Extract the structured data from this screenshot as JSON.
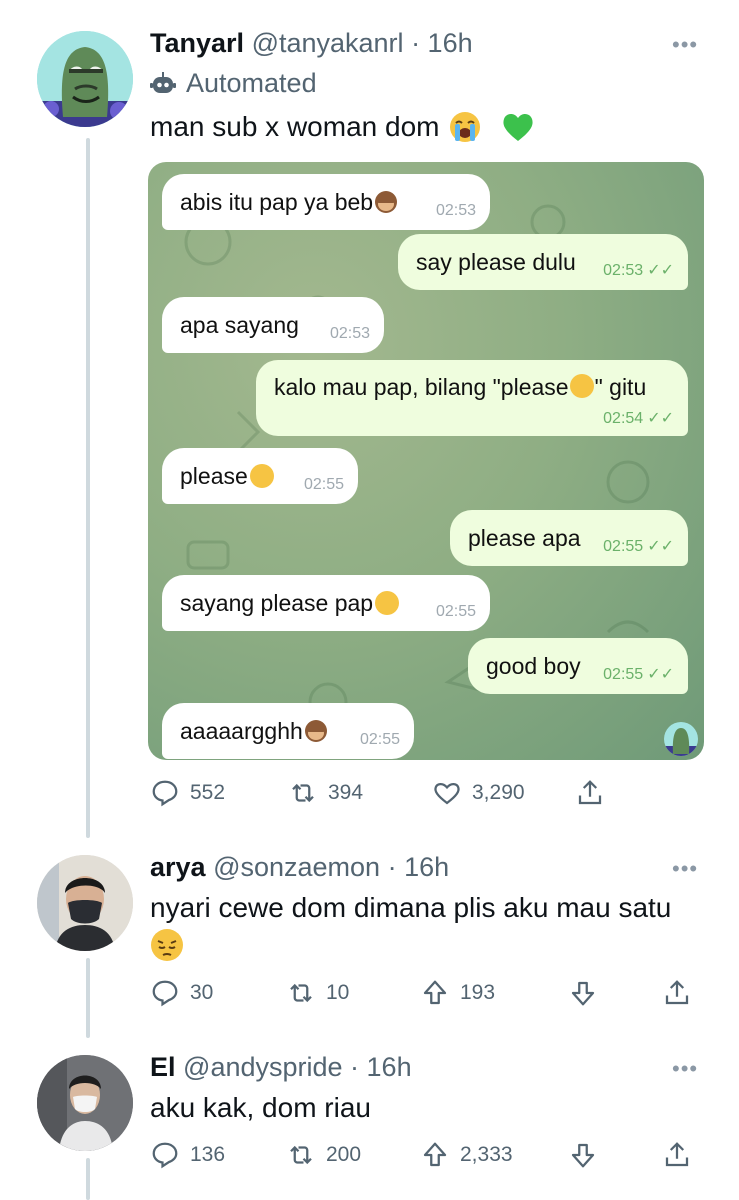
{
  "tweet1": {
    "name": "Tanyarl",
    "handle": "@tanyakanrl",
    "time": "· 16h",
    "automated_label": "Automated",
    "text": "man sub x woman dom",
    "stats": {
      "replies": "552",
      "retweets": "394",
      "likes": "3,290"
    }
  },
  "chat": {
    "messages": [
      {
        "dir": "in",
        "text": "abis itu pap ya beb",
        "time": "02:53"
      },
      {
        "dir": "out",
        "text": "say please dulu",
        "time": "02:53"
      },
      {
        "dir": "in",
        "text": "apa sayang",
        "time": "02:53"
      },
      {
        "dir": "out",
        "text": "kalo mau pap, bilang \"please",
        "text2": "\" gitu",
        "time": "02:54"
      },
      {
        "dir": "in",
        "text": "please",
        "time": "02:55"
      },
      {
        "dir": "out",
        "text": "please apa",
        "time": "02:55"
      },
      {
        "dir": "in",
        "text": "sayang please pap",
        "time": "02:55"
      },
      {
        "dir": "out",
        "text": "good boy",
        "time": "02:55"
      },
      {
        "dir": "in",
        "text": "aaaaargghh",
        "time": "02:55"
      }
    ]
  },
  "reply1": {
    "name": "arya",
    "handle": "@sonzaemon",
    "time": "· 16h",
    "text": "nyari cewe dom dimana plis aku mau satu",
    "stats": {
      "replies": "30",
      "retweets": "10",
      "upvotes": "193"
    }
  },
  "reply2": {
    "name": "El",
    "handle": "@andyspride",
    "time": "· 16h",
    "text": "aku kak, dom riau",
    "stats": {
      "replies": "136",
      "retweets": "200",
      "upvotes": "2,333"
    }
  },
  "colors": {
    "text": "#0f1419",
    "muted": "#536471",
    "thread": "#cfd9de",
    "chat_out": "#effdde",
    "heart_green": "#3cc14c"
  }
}
